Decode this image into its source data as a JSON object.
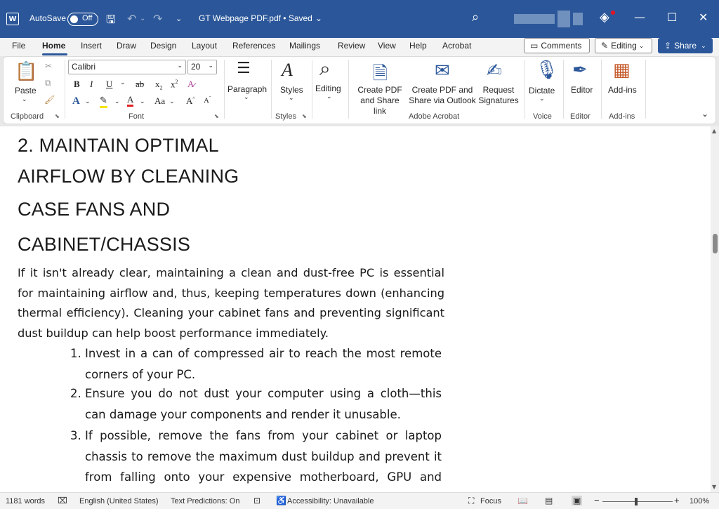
{
  "titlebar": {
    "app_icon": "word-icon",
    "autosave_label": "AutoSave",
    "autosave_state": "Off",
    "doc_title": "GT Webpage PDF.pdf • Saved",
    "title_chevron": "⌄",
    "accent": "#2b579a"
  },
  "tabs": [
    "File",
    "Home",
    "Insert",
    "Draw",
    "Design",
    "Layout",
    "References",
    "Mailings",
    "Review",
    "View",
    "Help",
    "Acrobat"
  ],
  "topright": {
    "comments": "Comments",
    "editing": "Editing",
    "share": "Share"
  },
  "ribbon": {
    "clipboard": {
      "paste": "Paste",
      "label": "Clipboard"
    },
    "font": {
      "name": "Calibri",
      "size": "20",
      "label": "Font"
    },
    "paragraph": {
      "label": "Paragraph"
    },
    "styles": {
      "button": "Styles",
      "label": "Styles"
    },
    "editing": {
      "button": "Editing"
    },
    "acrobat": {
      "create_pdf_l1": "Create PDF",
      "create_pdf_l2": "and Share link",
      "outlook_l1": "Create PDF and",
      "outlook_l2": "Share via Outlook",
      "request_l1": "Request",
      "request_l2": "Signatures",
      "label": "Adobe Acrobat"
    },
    "voice": {
      "button": "Dictate",
      "label": "Voice"
    },
    "editor": {
      "button": "Editor",
      "label": "Editor"
    },
    "addins": {
      "button": "Add-ins",
      "label": "Add-ins"
    }
  },
  "document": {
    "heading_lines": [
      "2. MAINTAIN OPTIMAL",
      "AIRFLOW BY CLEANING",
      "CASE FANS AND",
      "CABINET/CHASSIS"
    ],
    "paragraph": "If it isn't already clear, maintaining a clean and dust-free PC is essential for maintaining airflow and, thus, keeping temperatures down (enhancing thermal efficiency). Cleaning your cabinet fans and preventing significant dust buildup can help boost performance immediately.",
    "list": [
      {
        "num": "1.",
        "text": "Invest in a can of compressed air to reach the most remote corners of your PC."
      },
      {
        "num": "2.",
        "text": "Ensure you do not dust your computer using a cloth—this can damage your components and render it unusable."
      },
      {
        "num": "3.",
        "text": "If possible, remove the fans from your cabinet or laptop chassis to remove the maximum dust buildup and prevent it from falling onto your expensive motherboard, GPU and other components."
      }
    ]
  },
  "statusbar": {
    "words": "1181 words",
    "language": "English (United States)",
    "predictions": "Text Predictions: On",
    "accessibility": "Accessibility: Unavailable",
    "focus": "Focus",
    "zoom": "100%",
    "zoom_level": 0.5
  }
}
